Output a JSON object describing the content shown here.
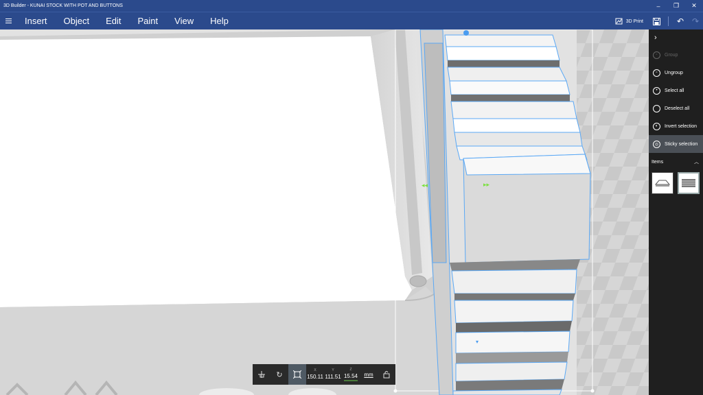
{
  "window": {
    "title": "3D Builder - KUNAI STOCK WITH POT AND BUTTONS",
    "minimize": "–",
    "maximize": "❐",
    "close": "✕"
  },
  "menu": {
    "items": [
      "Insert",
      "Object",
      "Edit",
      "Paint",
      "View",
      "Help"
    ],
    "print_label": "3D Print"
  },
  "toolbar": {
    "icons": [
      "move-icon",
      "rotate-icon",
      "scale-icon"
    ],
    "x_label": "X",
    "y_label": "Y",
    "z_label": "Z",
    "x_value": "150.11",
    "y_value": "111.51",
    "z_value": "15.54",
    "unit": "mm"
  },
  "panel": {
    "items": [
      {
        "label": "Group",
        "state": "disabled"
      },
      {
        "label": "Ungroup",
        "state": "normal"
      },
      {
        "label": "Select all",
        "state": "normal"
      },
      {
        "label": "Deselect all",
        "state": "normal"
      },
      {
        "label": "Invert selection",
        "state": "normal"
      },
      {
        "label": "Sticky selection",
        "state": "selected"
      }
    ],
    "items_header": "Items"
  },
  "colors": {
    "titlebar": "#2b4a8c",
    "panel": "#1f1f1f",
    "selection": "#4a9cf0",
    "gizmo": "#7ce040"
  }
}
